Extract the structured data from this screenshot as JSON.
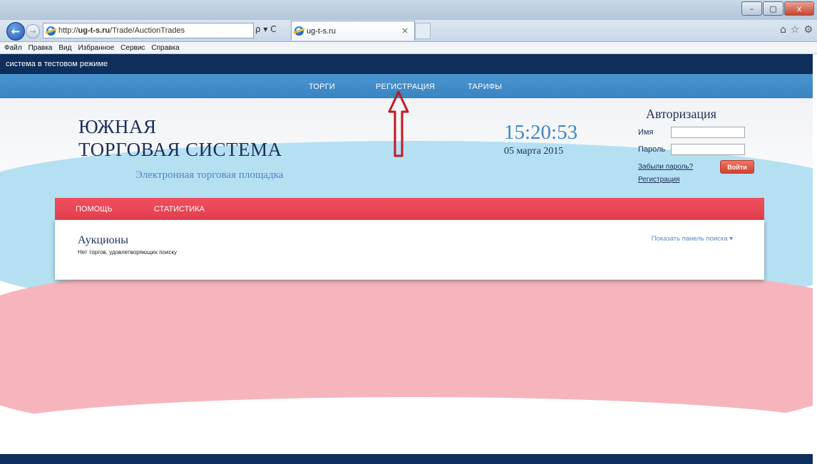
{
  "browser": {
    "url_prefix": "http://",
    "url_host": "ug-t-s.ru",
    "url_path": "/Trade/AuctionTrades",
    "addr_tools": "ρ ▾ C",
    "tab_title": "ug-t-s.ru",
    "tab_close": "×",
    "win_min": "–",
    "win_max": "▢",
    "win_close": "x",
    "back": "←",
    "forward": "→",
    "right_tools": [
      "⌂",
      "☆",
      "⚙"
    ],
    "menu": [
      "Файл",
      "Правка",
      "Вид",
      "Избранное",
      "Сервис",
      "Справка"
    ]
  },
  "site": {
    "notice": "система в тестовом режиме",
    "nav": [
      "ТОРГИ",
      "РЕГИСТРАЦИЯ",
      "ТАРИФЫ"
    ],
    "logo_line1": "ЮЖНАЯ",
    "logo_line2": "ТОРГОВАЯ СИСТЕМА",
    "tagline": "Электронная торговая площадка",
    "clock": "15:20:53",
    "date": "05 марта 2015",
    "auth": {
      "title": "Авторизация",
      "name_label": "Имя",
      "password_label": "Пароль",
      "forgot": "Забыли пароль?",
      "login_button": "Войти",
      "register": "Регистрация"
    },
    "subnav": [
      "ПОМОЩЬ",
      "СТАТИСТИКА"
    ],
    "panel": {
      "title": "Аукционы",
      "empty_text": "Нет торгов, удовлетворяющих поиску",
      "search_toggle": "Показать панель поиска ▾"
    }
  },
  "colors": {
    "dark_navy": "#0e2e5c",
    "nav_blue": "#3a84c2",
    "red_bar": "#e23e4e",
    "arrow": "#c01a24"
  }
}
